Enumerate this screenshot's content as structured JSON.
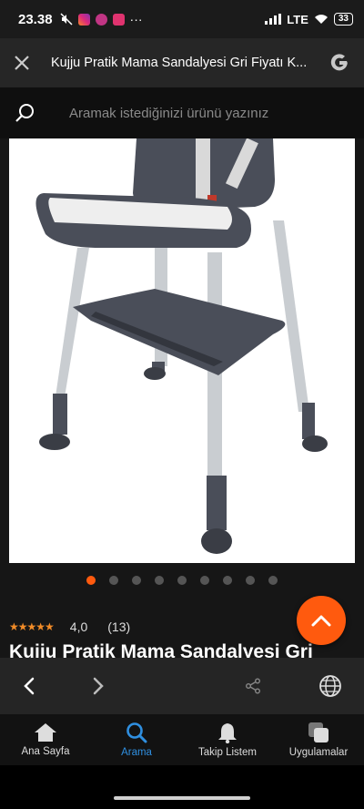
{
  "status_bar": {
    "time": "23.38",
    "more": "···",
    "network": "LTE",
    "battery": "33"
  },
  "url_bar": {
    "title": "Kujju Pratik Mama Sandalyesi Gri Fiyatı K..."
  },
  "search": {
    "placeholder": "Aramak istediğinizi ürünü yazınız"
  },
  "gallery": {
    "image_count": 9,
    "active_index": 0
  },
  "product": {
    "rating_stars": "★★★★★",
    "rating_value": "4,0",
    "review_count": "(13)",
    "title": "Kujju Pratik Mama Sandalyesi Gri"
  },
  "colors": {
    "accent": "#ff5a0e",
    "active_tab": "#2f8fe0"
  },
  "bottom_tabs": [
    {
      "label": "Ana Sayfa",
      "icon": "home-icon",
      "active": false
    },
    {
      "label": "Arama",
      "icon": "search-icon",
      "active": true
    },
    {
      "label": "Takip Listem",
      "icon": "bell-icon",
      "active": false
    },
    {
      "label": "Uygulamalar",
      "icon": "apps-icon",
      "active": false
    }
  ]
}
